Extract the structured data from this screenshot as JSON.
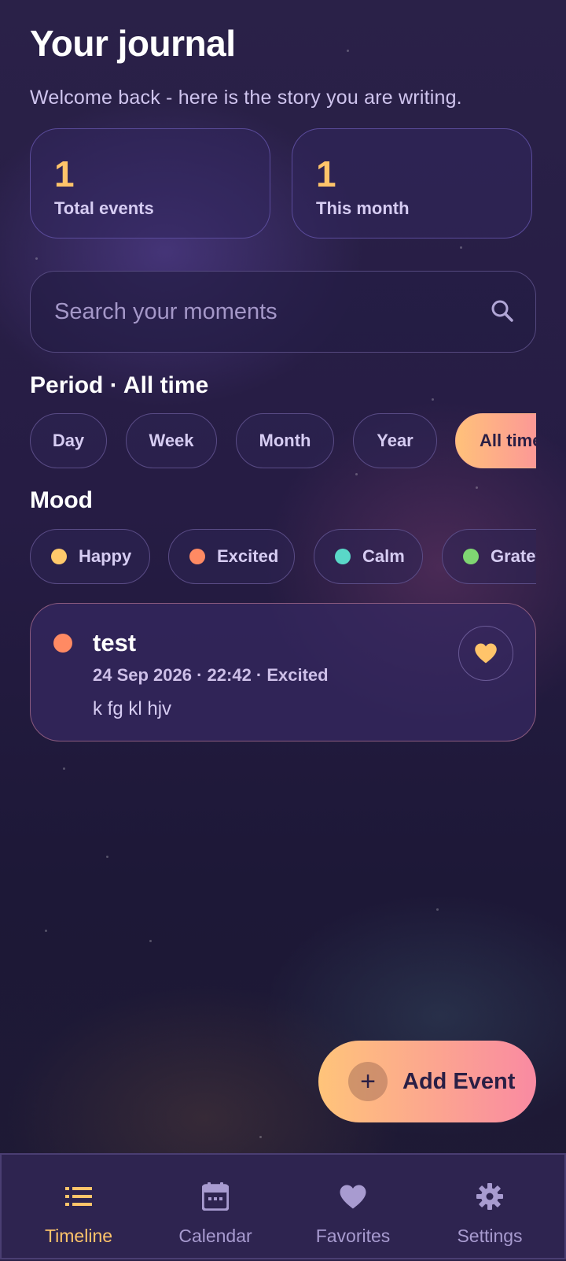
{
  "header": {
    "title": "Your journal",
    "subtitle": "Welcome back - here is the story you are writing."
  },
  "stats": [
    {
      "value": "1",
      "label": "Total events"
    },
    {
      "value": "1",
      "label": "This month"
    }
  ],
  "search": {
    "placeholder": "Search your moments",
    "value": "",
    "icon": "search-icon"
  },
  "period": {
    "label": "Period · All time",
    "chips": [
      "Day",
      "Week",
      "Month",
      "Year",
      "All time"
    ],
    "selected": "All time"
  },
  "mood": {
    "label": "Mood",
    "chips": [
      {
        "label": "Happy",
        "color": "#ffc96b"
      },
      {
        "label": "Excited",
        "color": "#ff8a63"
      },
      {
        "label": "Calm",
        "color": "#5ad8c8"
      },
      {
        "label": "Grateful",
        "color": "#7fd672"
      }
    ]
  },
  "events": [
    {
      "title": "test",
      "meta": "24 Sep 2026 · 22:42 · Excited",
      "body": "k fg kl hjv",
      "mood_color": "#ff8a63",
      "favorite": true,
      "favorite_icon": "heart-icon"
    }
  ],
  "fab": {
    "label": "Add Event",
    "icon": "plus-icon"
  },
  "nav": {
    "items": [
      {
        "label": "Timeline",
        "icon": "list-icon",
        "active": true
      },
      {
        "label": "Calendar",
        "icon": "calendar-icon",
        "active": false
      },
      {
        "label": "Favorites",
        "icon": "heart-icon",
        "active": false
      },
      {
        "label": "Settings",
        "icon": "gear-icon",
        "active": false
      }
    ]
  },
  "colors": {
    "accent": "#ffc46a",
    "gradient_start": "#ffc47a",
    "gradient_end": "#f98aa2",
    "nav_inactive": "#a89bd0"
  }
}
